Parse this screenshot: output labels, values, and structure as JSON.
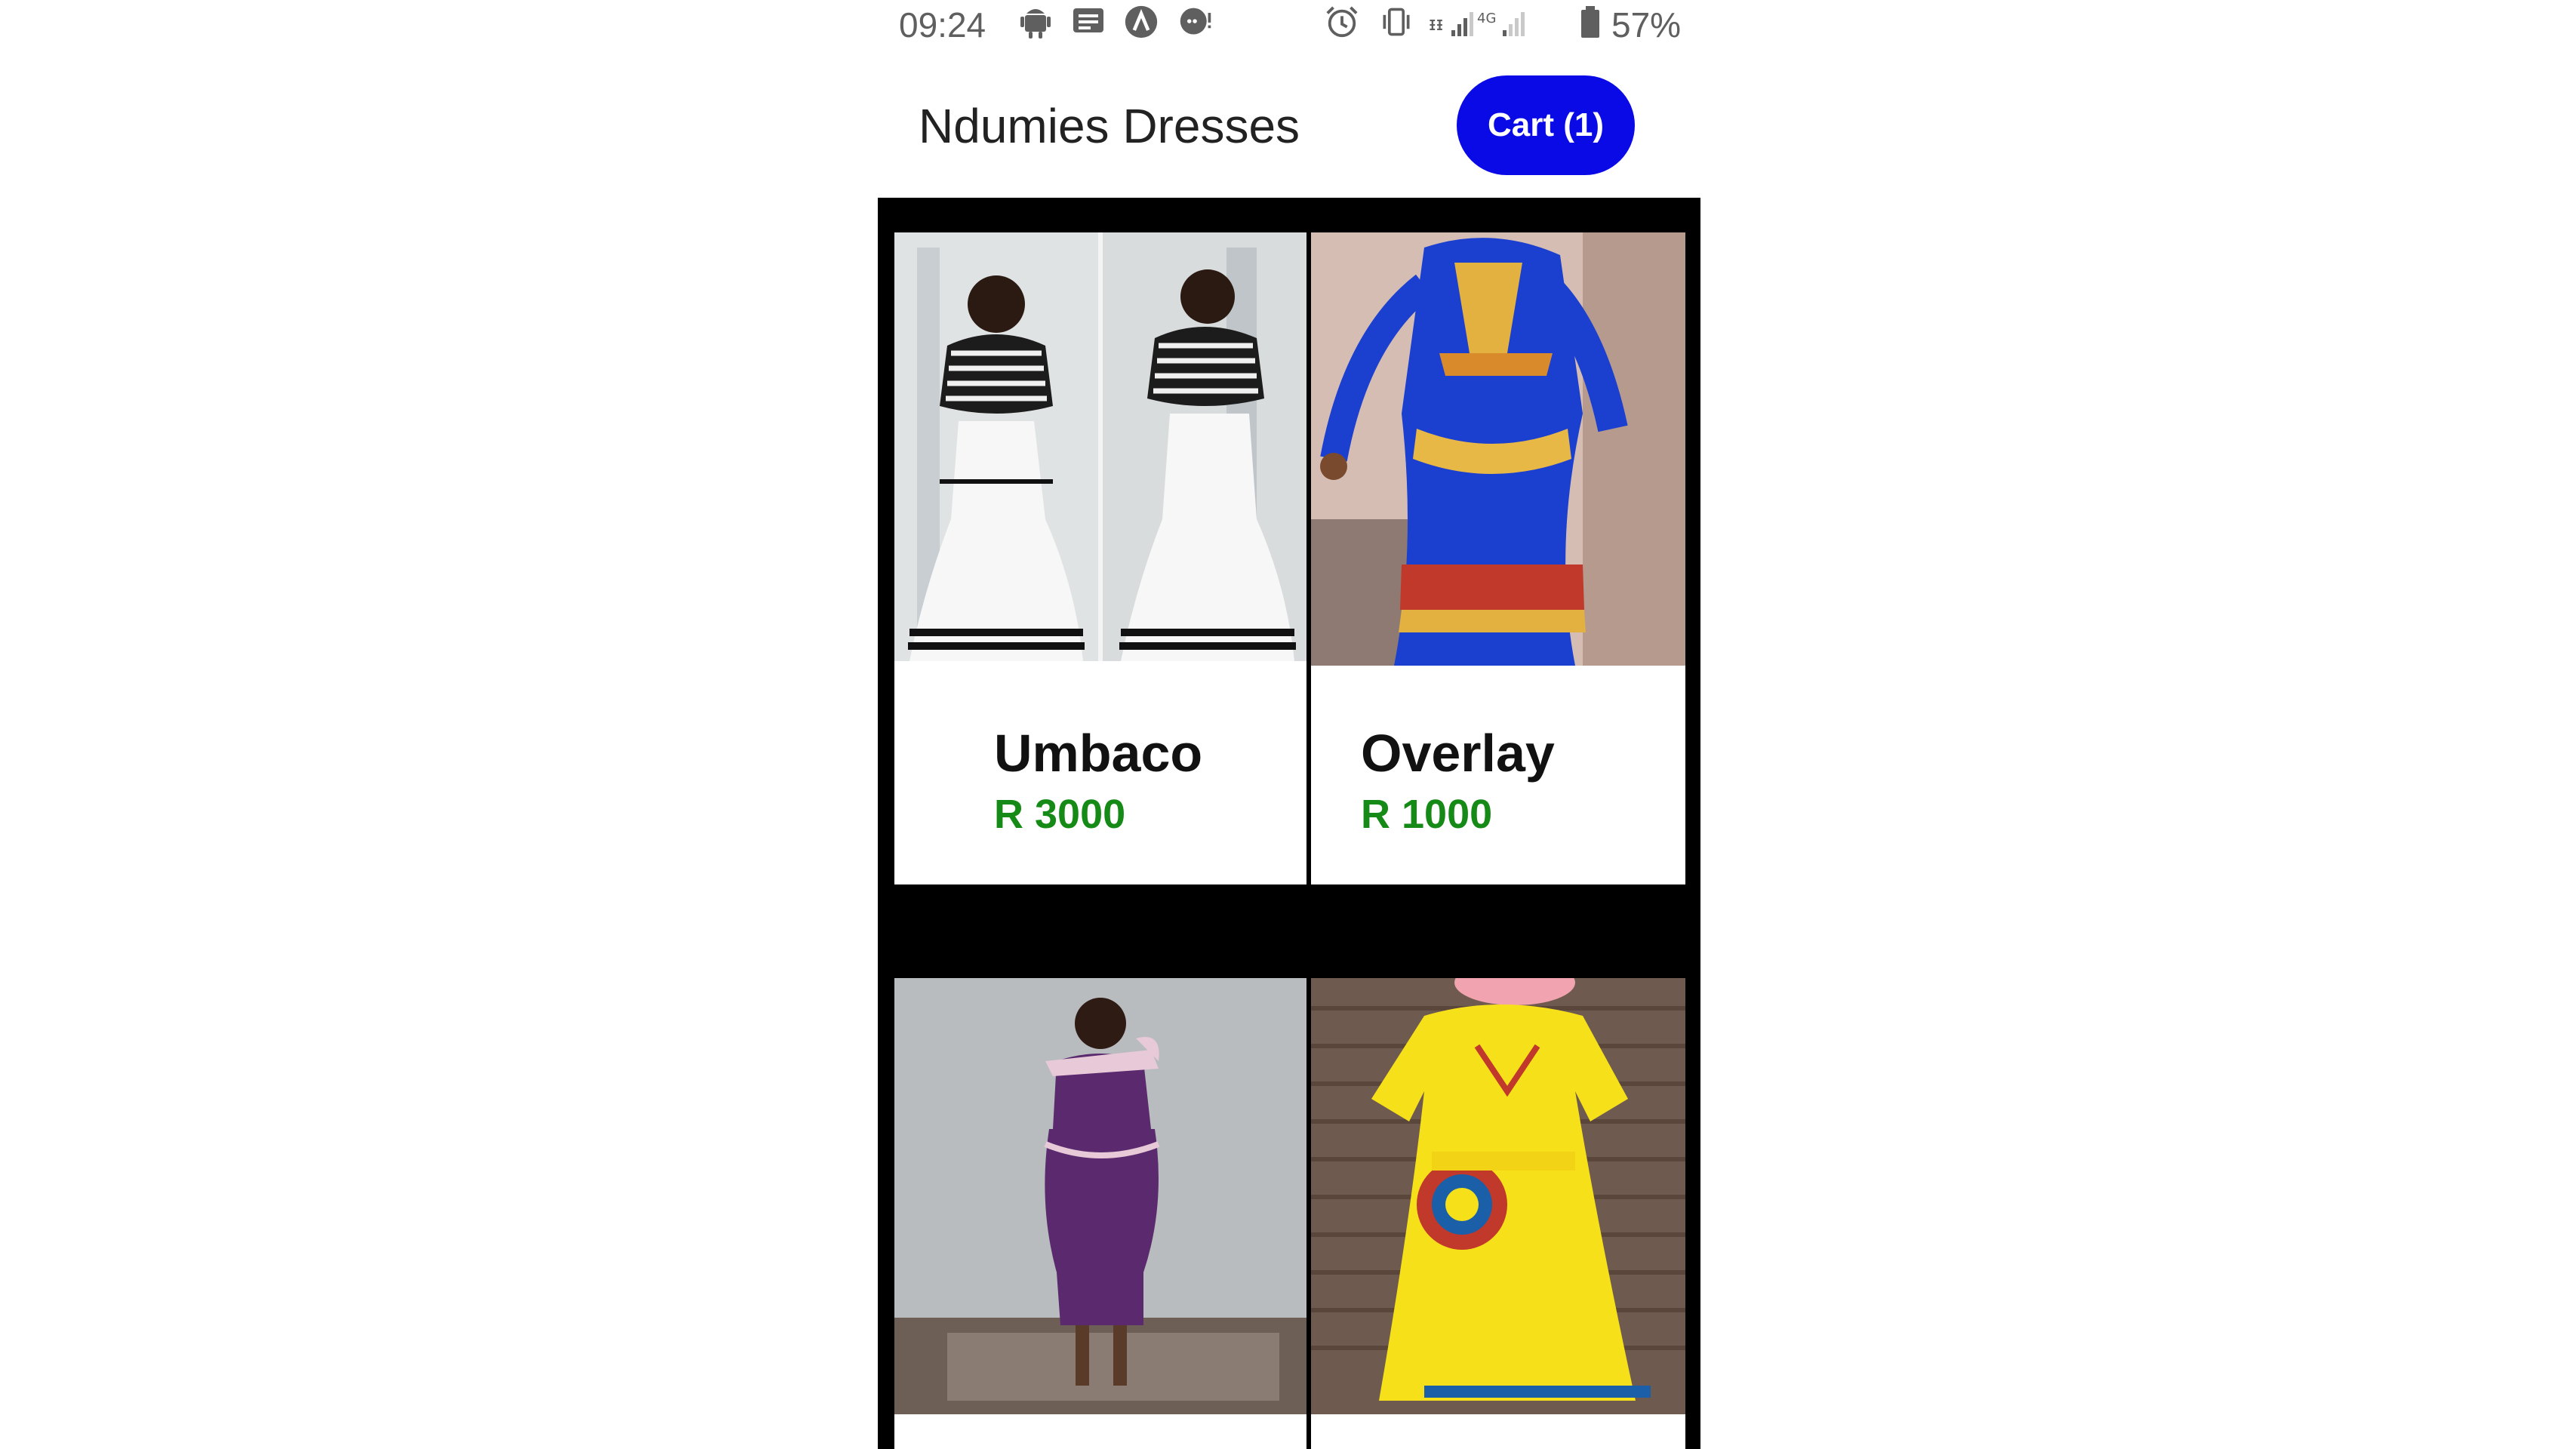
{
  "status_bar": {
    "time": "09:24",
    "battery": "57%",
    "icons": [
      "android-icon",
      "message-icon",
      "app-icon",
      "chat-icon",
      "alarm-icon",
      "vibrate-icon",
      "signal-icon",
      "battery-icon"
    ],
    "network": "4G"
  },
  "header": {
    "title": "Ndumies Dresses",
    "cart_label": "Cart (1)"
  },
  "products": [
    {
      "name": "Umbaco",
      "price": "R 3000"
    },
    {
      "name": "Overlay",
      "price": "R 1000"
    },
    {
      "name": "",
      "price": ""
    },
    {
      "name": "",
      "price": ""
    }
  ],
  "colors": {
    "cart_button": "#0a0ae6",
    "price": "#168a16",
    "grid_background": "#000000"
  }
}
